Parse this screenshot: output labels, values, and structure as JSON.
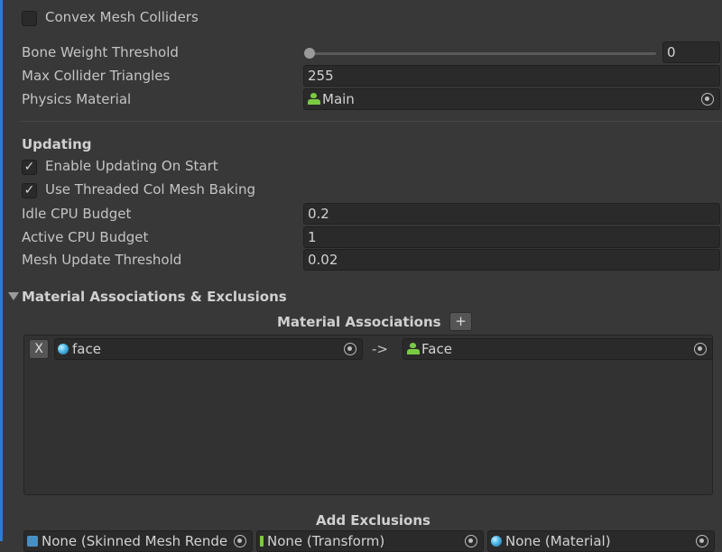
{
  "colors": {
    "accent": "#2a7bd6",
    "background": "#383838",
    "field": "#2a2a2a",
    "physics_icon": "#7ac943"
  },
  "collider": {
    "convex_label": "Convex Mesh Colliders",
    "convex_checked": false,
    "bone_weight_label": "Bone Weight Threshold",
    "bone_weight_value": "0",
    "bone_weight_slider": 0,
    "max_tri_label": "Max Collider Triangles",
    "max_tri_value": "255",
    "phys_mat_label": "Physics Material",
    "phys_mat_value": "Main",
    "phys_mat_icon": "physics-material-icon"
  },
  "updating": {
    "heading": "Updating",
    "enable_label": "Enable Updating On Start",
    "enable_checked": true,
    "threaded_label": "Use Threaded Col Mesh Baking",
    "threaded_checked": true,
    "idle_label": "Idle CPU Budget",
    "idle_value": "0.2",
    "active_label": "Active CPU Budget",
    "active_value": "1",
    "threshold_label": "Mesh Update Threshold",
    "threshold_value": "0.02"
  },
  "material": {
    "section_title": "Material Associations & Exclusions",
    "assoc_title": "Material Associations",
    "add_label": "+",
    "row": {
      "remove_label": "X",
      "from_value": "face",
      "from_icon": "material-sphere-icon",
      "arrow": "->",
      "to_value": "Face",
      "to_icon": "physics-material-icon"
    },
    "exclusions_title": "Add Exclusions",
    "excl_skinned": "None (Skinned Mesh Rende",
    "excl_transform": "None (Transform)",
    "excl_material": "None (Material)"
  }
}
